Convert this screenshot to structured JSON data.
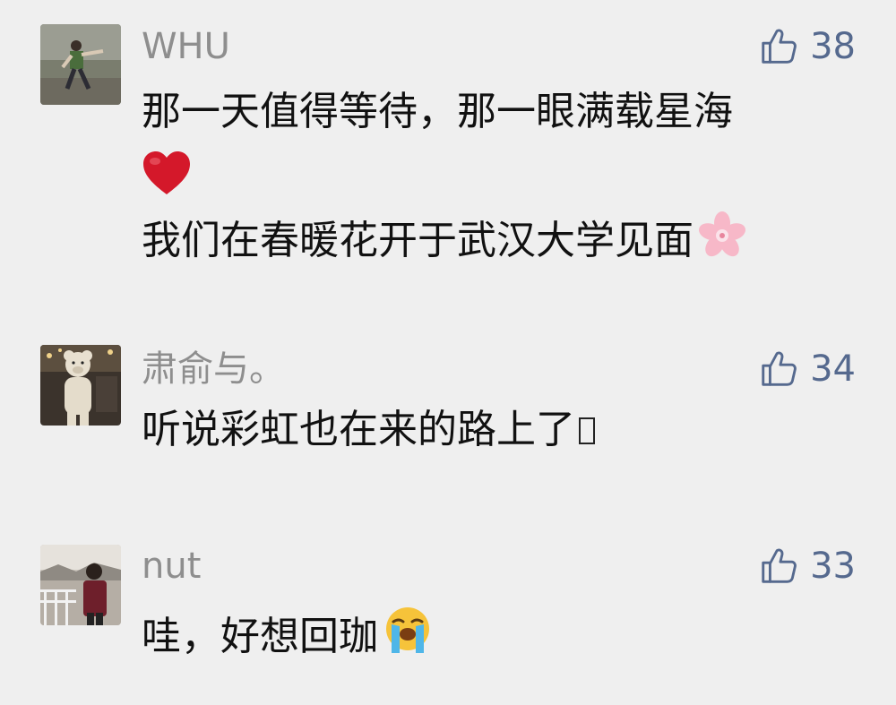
{
  "comments": [
    {
      "username": "WHU",
      "likes": "38",
      "line1": "那一天值得等待，那一眼满载星海",
      "line3": "我们在春暖花开于武汉大学见面",
      "emojis": [
        "heart",
        "cherry-blossom"
      ]
    },
    {
      "username": "肃俞与。",
      "likes": "34",
      "line1": "听说彩虹也在来的路上了",
      "emojis": [
        "unknown-glyph"
      ]
    },
    {
      "username": "nut",
      "likes": "33",
      "line1": "哇，好想回珈",
      "emojis": [
        "loudly-crying-face"
      ]
    }
  ],
  "icons": {
    "like": "thumbs-up-outline-icon"
  },
  "colors": {
    "background": "#efefef",
    "username": "#8e8e8e",
    "like_count": "#55698e",
    "text": "#111111"
  }
}
